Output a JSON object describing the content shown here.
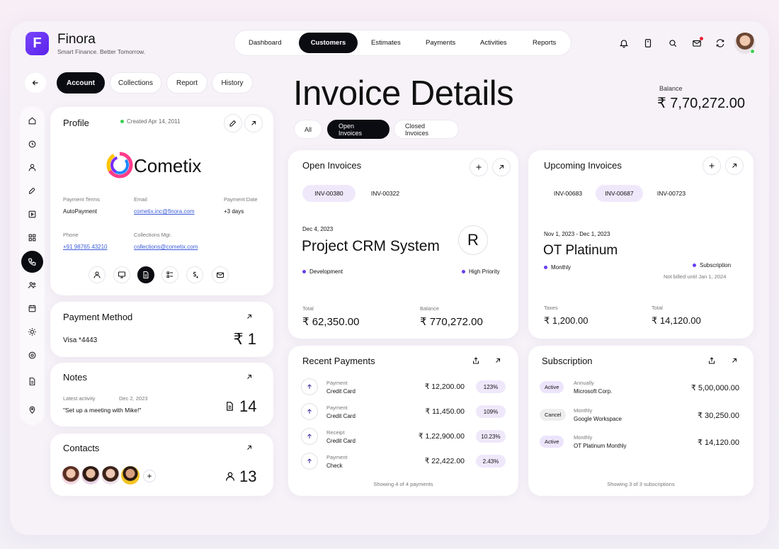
{
  "app": {
    "logo_letter": "F",
    "name": "Finora",
    "tagline": "Smart Finance. Better Tomorrow."
  },
  "nav": {
    "tabs": [
      "Dashboard",
      "Customers",
      "Estimates",
      "Payments",
      "Activities",
      "Reports"
    ],
    "active": "Customers"
  },
  "subnav": {
    "tabs": [
      "Account",
      "Collections",
      "Report",
      "History"
    ],
    "active": "Account"
  },
  "profile": {
    "title": "Profile",
    "created": "Created Apr 14, 2011",
    "company": "Cometix",
    "payment_terms_label": "Payment Terms",
    "payment_terms": "AutoPayment",
    "email_label": "Email",
    "email": "cometix.inc@finora.com",
    "payment_date_label": "Payment Date",
    "payment_date": "+3 days",
    "phone_label": "Phone",
    "phone": "+91 98765 43210",
    "collections_label": "Collections Mgr.",
    "collections_email": "collections@cometix.com"
  },
  "payment_method": {
    "title": "Payment Method",
    "card": "Visa *4443",
    "count": "₹ 1"
  },
  "notes": {
    "title": "Notes",
    "latest_label": "Latest activity",
    "date": "Dec 2, 2023",
    "text": "\"Set up a meeting with Mike!\"",
    "count": "14"
  },
  "contacts": {
    "title": "Contacts",
    "count": "13"
  },
  "page": {
    "title": "Invoice Details",
    "balance_label": "Balance",
    "balance": "₹ 7,70,272.00"
  },
  "filters": {
    "tabs": [
      "All",
      "Open Invoices",
      "Closed Invoices"
    ],
    "active": "Open Invoices"
  },
  "open_invoices": {
    "title": "Open Invoices",
    "tabs": [
      "INV-00380",
      "INV-00322"
    ],
    "active": "INV-00380",
    "date": "Dec 4, 2023",
    "project": "Project CRM System",
    "avatar": "R",
    "tag1": "Development",
    "tag2": "High Priority",
    "total_label": "Total",
    "total": "₹ 62,350.00",
    "balance_label": "Balance",
    "balance": "₹ 770,272.00"
  },
  "upcoming_invoices": {
    "title": "Upcoming Invoices",
    "tabs": [
      "INV-00683",
      "INV-00687",
      "INV-00723"
    ],
    "active": "INV-00687",
    "date": "Nov 1, 2023 - Dec 1, 2023",
    "plan": "OT Platinum",
    "tag1": "Monthly",
    "tag2": "Subscription",
    "note": "Not billed until Jan 1, 2024",
    "taxes_label": "Taxes",
    "taxes": "₹ 1,200.00",
    "total_label": "Total",
    "total": "₹ 14,120.00"
  },
  "recent_payments": {
    "title": "Recent Payments",
    "footer": "Showing 4 of 4 payments",
    "rows": [
      {
        "type": "Payment",
        "method": "Credit Card",
        "amount": "₹ 12,200.00",
        "pct": "123%"
      },
      {
        "type": "Payment",
        "method": "Credit Card",
        "amount": "₹ 11,450.00",
        "pct": "109%"
      },
      {
        "type": "Receipt",
        "method": "Credit Card",
        "amount": "₹ 1,22,900.00",
        "pct": "10.23%"
      },
      {
        "type": "Payment",
        "method": "Check",
        "amount": "₹ 22,422.00",
        "pct": "2.43%"
      }
    ]
  },
  "subscription": {
    "title": "Subscription",
    "footer": "Showing 3 of 3 subscriptions",
    "rows": [
      {
        "status": "Active",
        "period": "Annually",
        "name": "Microsoft Corp.",
        "amount": "₹ 5,00,000.00"
      },
      {
        "status": "Cancel",
        "period": "Monthly",
        "name": "Google Workspace",
        "amount": "₹ 30,250.00"
      },
      {
        "status": "Active",
        "period": "Monthly",
        "name": "OT Platinum Monthly",
        "amount": "₹ 14,120.00"
      }
    ]
  },
  "colors": {
    "accent": "#6a3df0",
    "dark": "#0b0b12",
    "active_badge": "#ece4fb",
    "cancel_badge": "#eeeeee",
    "online": "#3ccf4e"
  }
}
